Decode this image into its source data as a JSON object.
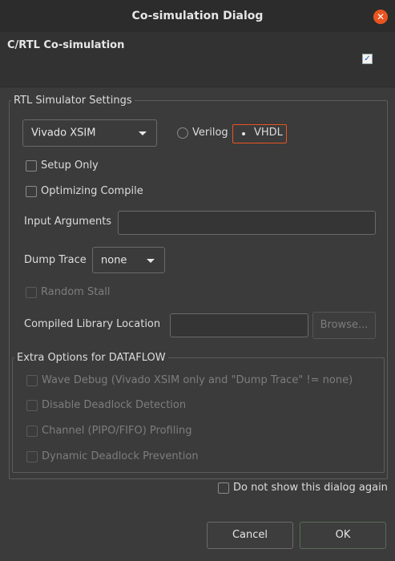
{
  "window": {
    "title": "Co-simulation Dialog",
    "close_glyph": "✕"
  },
  "header": {
    "title": "C/RTL Co-simulation",
    "check_glyph": "✓"
  },
  "rtl_settings": {
    "legend": "RTL Simulator Settings",
    "simulator": "Vivado XSIM",
    "language_options": [
      "Verilog",
      "VHDL"
    ],
    "selected_language": "VHDL",
    "setup_only": "Setup Only",
    "optimizing_compile": "Optimizing Compile",
    "input_arguments_label": "Input Arguments",
    "input_arguments_value": "",
    "dump_trace_label": "Dump Trace",
    "dump_trace_value": "none",
    "random_stall": "Random Stall",
    "compiled_library_label": "Compiled Library Location",
    "compiled_library_value": "",
    "browse": "Browse..."
  },
  "dataflow": {
    "legend": "Extra Options for DATAFLOW",
    "options": [
      "Wave Debug (Vivado XSIM only and \"Dump Trace\" != none)",
      "Disable Deadlock Detection",
      "Channel (PIPO/FIFO) Profiling",
      "Dynamic Deadlock Prevention"
    ]
  },
  "footer": {
    "dont_show": "Do not show this dialog again",
    "cancel": "Cancel",
    "ok": "OK"
  }
}
